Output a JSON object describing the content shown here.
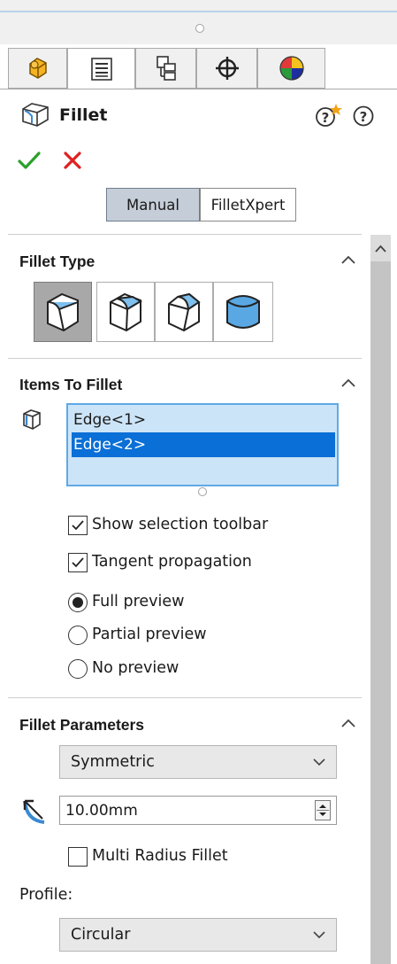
{
  "panel": {
    "title": "Fillet",
    "ok_icon": "checkmark-icon",
    "cancel_icon": "x-icon"
  },
  "tabs": [
    {
      "name": "featuremanager-tab",
      "icon": "feature-tree-icon"
    },
    {
      "name": "propertymanager-tab",
      "icon": "property-list-icon",
      "active": true
    },
    {
      "name": "configurationmanager-tab",
      "icon": "configuration-icon"
    },
    {
      "name": "dimxpert-tab",
      "icon": "crosshair-icon"
    },
    {
      "name": "display-manager-tab",
      "icon": "appearance-ball-icon"
    }
  ],
  "mode": {
    "manual_label": "Manual",
    "filletxpert_label": "FilletXpert",
    "selected": "Manual"
  },
  "fillet_type": {
    "title": "Fillet Type",
    "options": [
      "constant-size-fillet",
      "variable-size-fillet",
      "face-fillet",
      "full-round-fillet"
    ],
    "selected_index": 0
  },
  "items_to_fillet": {
    "title": "Items To Fillet",
    "items": [
      "Edge<1>",
      "Edge<2>"
    ],
    "selected_index": 1,
    "show_selection_toolbar_label": "Show selection toolbar",
    "show_selection_toolbar_checked": true,
    "tangent_propagation_label": "Tangent propagation",
    "tangent_propagation_checked": true,
    "preview_options": [
      "Full preview",
      "Partial preview",
      "No preview"
    ],
    "preview_selected": "Full preview"
  },
  "fillet_parameters": {
    "title": "Fillet Parameters",
    "method": "Symmetric",
    "radius": "10.00mm",
    "multi_radius_label": "Multi Radius Fillet",
    "multi_radius_checked": false,
    "profile_label": "Profile:",
    "profile": "Circular"
  },
  "colors": {
    "selection_blue": "#0a6fd6",
    "list_background": "#cce4f7",
    "ok_green": "#2aa12a",
    "cancel_red": "#e02020"
  }
}
